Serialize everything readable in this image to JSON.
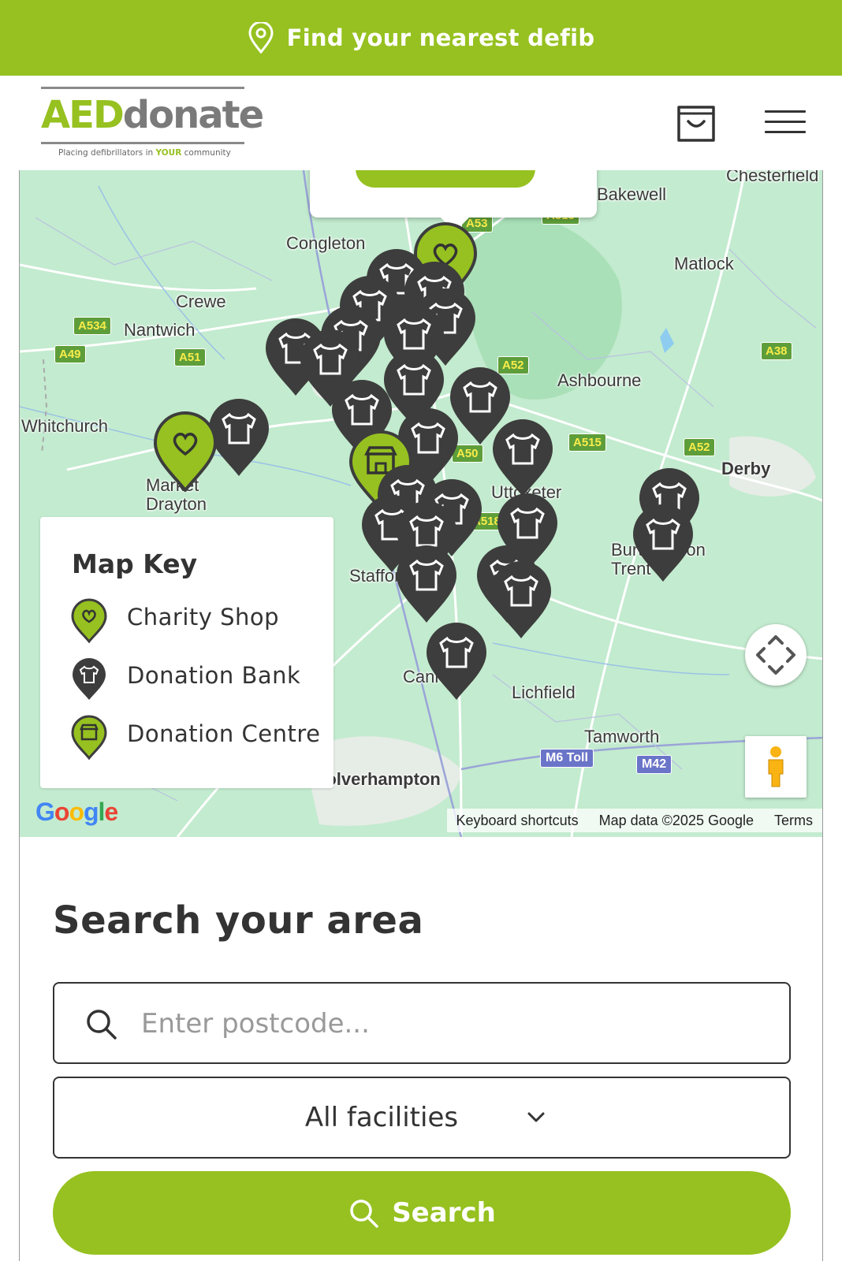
{
  "banner": {
    "text": "Find your nearest defib",
    "icon": "map-pin-icon"
  },
  "header": {
    "logo": {
      "part1": "AED",
      "part2": "donate",
      "tagline_pre": "Placing defibrillators in ",
      "tagline_highlight": "YOUR",
      "tagline_post": " community"
    },
    "cart_icon": "shopping-bag-icon",
    "menu_icon": "hamburger-menu-icon"
  },
  "map": {
    "place_labels": [
      "Chesterfield",
      "Bakewell",
      "Congleton",
      "Matlock",
      "Crewe",
      "Nantwich",
      "Ashbourne",
      "Whitchurch",
      "Derby",
      "Market Drayton",
      "Uttoxeter",
      "Burton upon Trent",
      "Stafford",
      "Cannock",
      "Lichfield",
      "Tamworth",
      "Wolverhampton"
    ],
    "road_labels": [
      "A53",
      "A515",
      "A534",
      "A49",
      "A51",
      "A52",
      "A38",
      "A515",
      "A52",
      "A50",
      "A518"
    ],
    "motorway_labels": [
      "M6 Toll",
      "M42"
    ],
    "key": {
      "title": "Map Key",
      "items": [
        {
          "label": "Charity Shop",
          "icon": "heart-marker-icon"
        },
        {
          "label": "Donation Bank",
          "icon": "tshirt-marker-icon"
        },
        {
          "label": "Donation Centre",
          "icon": "store-marker-icon"
        }
      ]
    },
    "footer": {
      "shortcuts": "Keyboard shortcuts",
      "data": "Map data ©2025 Google",
      "terms": "Terms"
    },
    "google_logo": "Google",
    "colors": {
      "brand_green": "#96c120",
      "marker_dark": "#3d3d3d"
    }
  },
  "search": {
    "title": "Search your area",
    "postcode_placeholder": "Enter postcode...",
    "facility_selected": "All facilities",
    "button_label": "Search"
  }
}
